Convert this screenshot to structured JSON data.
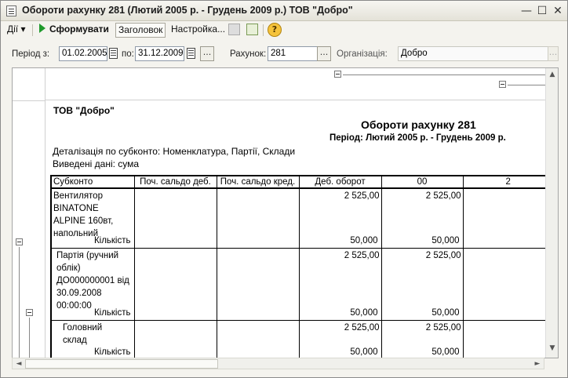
{
  "window": {
    "title": "Обороти рахунку 281 (Лютий 2005 р. - Грудень 2009 р.) ТОВ \"Добро\"",
    "min_label": "—",
    "max_label": "☐",
    "close_label": "✕"
  },
  "toolbar": {
    "actions_label": "Дії ▾",
    "generate_label": "Сформувати",
    "header_label": "Заголовок",
    "settings_label": "Настройка...",
    "help_label": "?"
  },
  "filters": {
    "period_from_label": "Період з:",
    "period_from_value": "01.02.2005",
    "period_to_label": "по:",
    "period_to_value": "31.12.2009",
    "ellipsis": "...",
    "account_label": "Рахунок:",
    "account_value": "281",
    "org_label": "Організація:",
    "org_value": "Добро"
  },
  "report": {
    "company": "ТОВ \"Добро\"",
    "title": "Обороти рахунку 281",
    "period": "Період: Лютий 2005 р. - Грудень 2009 р.",
    "detail": "Деталізація по субконто: Номенклатура, Партії, Склади",
    "output": "Виведені дані: сума",
    "columns": [
      "Субконто",
      "Поч. сальдо деб.",
      "Поч. сальдо кред.",
      "Деб. оборот",
      "00",
      "2"
    ],
    "quantity_label": "Кількість",
    "rows": [
      {
        "name": "Вентилятор BINATONE ALPINE 160вт, напольний",
        "debit_turnover": "2 525,00",
        "col00": "2 525,00",
        "qty_debit": "50,000",
        "qty_col00": "50,000"
      },
      {
        "name": "Партія (ручний облік) ДО000000001 від 30.09.2008 00:00:00",
        "debit_turnover": "2 525,00",
        "col00": "2 525,00",
        "qty_debit": "50,000",
        "qty_col00": "50,000"
      },
      {
        "name": "Головний склад",
        "debit_turnover": "2 525,00",
        "col00": "2 525,00",
        "qty_debit": "50,000",
        "qty_col00": "50,000"
      }
    ]
  },
  "scroll": {
    "up": "▲",
    "down": "▼",
    "left": "◄",
    "right": "►"
  }
}
